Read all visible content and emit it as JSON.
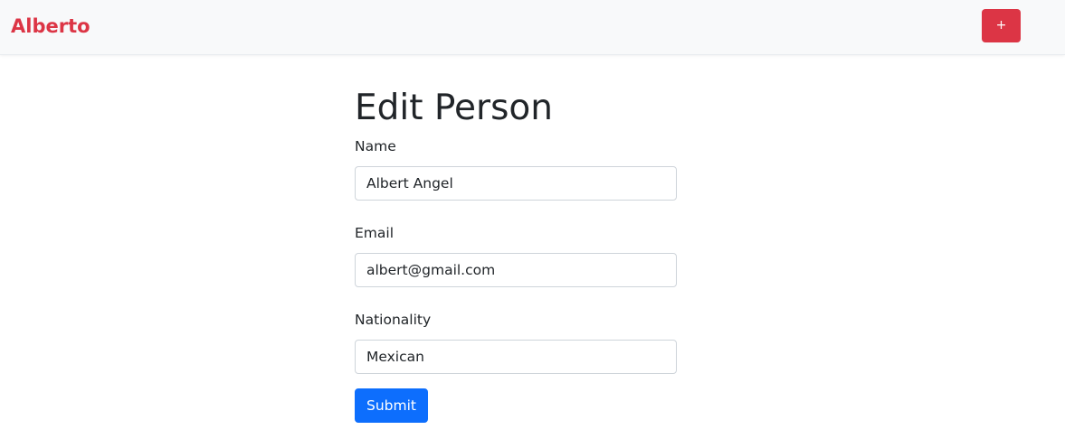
{
  "navbar": {
    "brand": "Alberto",
    "add_button_label": "+"
  },
  "main": {
    "title": "Edit Person",
    "fields": [
      {
        "label": "Name",
        "value": "Albert Angel"
      },
      {
        "label": "Email",
        "value": "albert@gmail.com"
      },
      {
        "label": "Nationality",
        "value": "Mexican"
      }
    ],
    "submit_label": "Submit"
  },
  "colors": {
    "brand": "#dc3545",
    "primary": "#0d6efd",
    "navbar_bg": "#f8f9fa"
  }
}
